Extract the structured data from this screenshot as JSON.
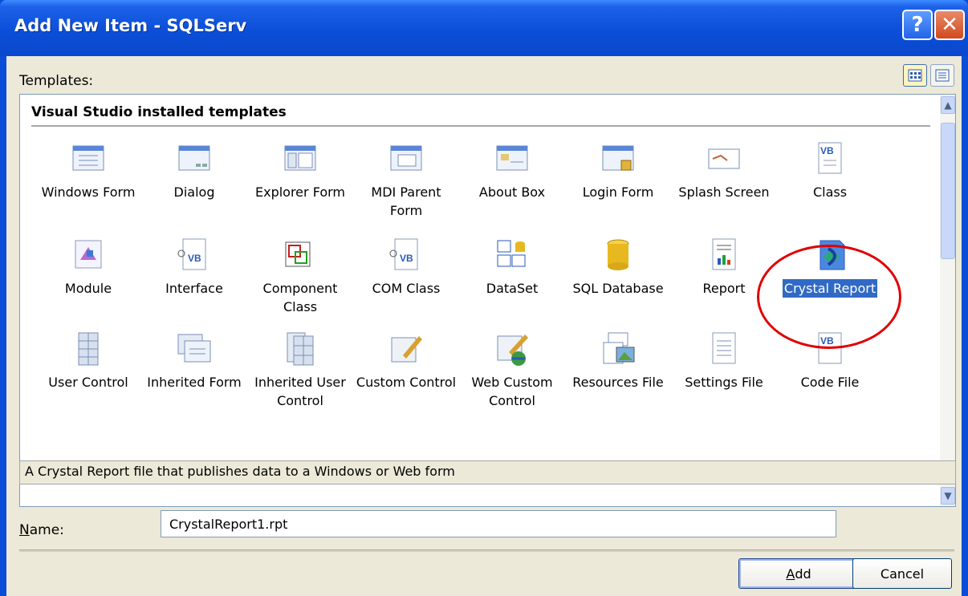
{
  "window": {
    "title": "Add New Item - SQLServ",
    "help_label": "?",
    "close_label": "✕"
  },
  "templates": {
    "label": "Templates:",
    "section_title": "Visual Studio installed templates",
    "items": [
      {
        "label": "Windows Form",
        "icon": "windows-form-icon"
      },
      {
        "label": "Dialog",
        "icon": "dialog-icon"
      },
      {
        "label": "Explorer Form",
        "icon": "explorer-form-icon"
      },
      {
        "label": "MDI Parent Form",
        "icon": "mdi-parent-form-icon"
      },
      {
        "label": "About Box",
        "icon": "about-box-icon"
      },
      {
        "label": "Login Form",
        "icon": "login-form-icon"
      },
      {
        "label": "Splash Screen",
        "icon": "splash-screen-icon"
      },
      {
        "label": "Class",
        "icon": "vb-class-icon"
      },
      {
        "label": "Module",
        "icon": "module-icon"
      },
      {
        "label": "Interface",
        "icon": "interface-icon"
      },
      {
        "label": "Component Class",
        "icon": "component-class-icon"
      },
      {
        "label": "COM Class",
        "icon": "com-class-icon"
      },
      {
        "label": "DataSet",
        "icon": "dataset-icon"
      },
      {
        "label": "SQL Database",
        "icon": "sql-database-icon"
      },
      {
        "label": "Report",
        "icon": "report-icon"
      },
      {
        "label": "Crystal Report",
        "icon": "crystal-report-icon",
        "selected": true
      },
      {
        "label": "User Control",
        "icon": "user-control-icon"
      },
      {
        "label": "Inherited Form",
        "icon": "inherited-form-icon"
      },
      {
        "label": "Inherited User Control",
        "icon": "inherited-user-control-icon"
      },
      {
        "label": "Custom Control",
        "icon": "custom-control-icon"
      },
      {
        "label": "Web Custom Control",
        "icon": "web-custom-control-icon"
      },
      {
        "label": "Resources File",
        "icon": "resources-file-icon"
      },
      {
        "label": "Settings File",
        "icon": "settings-file-icon"
      },
      {
        "label": "Code File",
        "icon": "code-file-icon"
      }
    ]
  },
  "description": "A Crystal Report file that publishes data to a Windows or Web form",
  "name_field": {
    "label_underlined": "N",
    "label_rest": "ame:",
    "value": "CrystalReport1.rpt"
  },
  "buttons": {
    "add_underlined": "A",
    "add_rest": "dd",
    "cancel": "Cancel"
  },
  "colors": {
    "titlebar": "#0a4dd6",
    "selection": "#316ac5",
    "highlight_circle": "#e00000",
    "dialog_face": "#ece9d8"
  }
}
